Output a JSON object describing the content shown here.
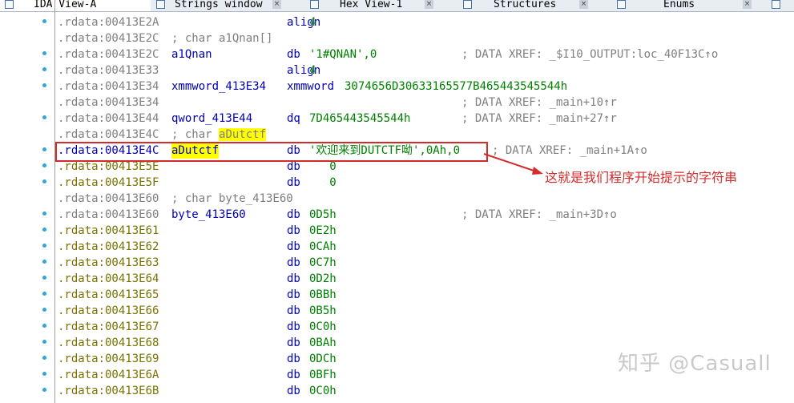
{
  "tabs": [
    {
      "label": "IDA View-A",
      "icon": "ida-view-icon",
      "active": true
    },
    {
      "label": "Strings window",
      "icon": "strings-icon",
      "active": false
    },
    {
      "label": "Hex View-1",
      "icon": "hex-view-icon",
      "active": false
    },
    {
      "label": "Structures",
      "icon": "structures-icon",
      "active": false
    },
    {
      "label": "Enums",
      "icon": "enums-icon",
      "active": false
    },
    {
      "label": "",
      "icon": "imports-icon",
      "active": false
    }
  ],
  "close_glyph": "×",
  "rows": [
    {
      "addr": ".rdata:00413E2A",
      "name": "",
      "mnemonic": "align",
      "operand": "4",
      "comment": ""
    },
    {
      "addr": ".rdata:00413E2C",
      "decl": "; char a1Qnan[]"
    },
    {
      "addr": ".rdata:00413E2C",
      "name": "a1Qnan",
      "mnemonic": "db",
      "operand": "'1#QNAN',0",
      "comment": "; DATA XREF: _$I10_OUTPUT:loc_40F13C↑o"
    },
    {
      "addr": ".rdata:00413E33",
      "name": "",
      "mnemonic": "align",
      "operand": "4",
      "comment": ""
    },
    {
      "addr": ".rdata:00413E34",
      "name": "xmmword_413E34",
      "mnemonic": "xmmword",
      "operand": "3074656D30633165577B465443545544h",
      "comment": ""
    },
    {
      "addr": ".rdata:00413E34",
      "name": "",
      "mnemonic": "",
      "operand": "",
      "comment": "; DATA XREF: _main+10↑r"
    },
    {
      "addr": ".rdata:00413E44",
      "name": "qword_413E44",
      "mnemonic": "dq",
      "operand": "7D465443545544h",
      "comment": "; DATA XREF: _main+27↑r"
    },
    {
      "addr": ".rdata:00413E4C",
      "decl_prefix": "; char ",
      "decl_hl": "aDutctf"
    },
    {
      "addr": ".rdata:00413E4C",
      "name": "aDutctf",
      "mnemonic": "db",
      "operand": "'欢迎来到DUTCTF呦',0Ah,0",
      "comment": "; DATA XREF: _main+1A↑o"
    },
    {
      "addr": ".rdata:00413E5E",
      "name": "",
      "mnemonic": "db",
      "operand": "   0",
      "comment": ""
    },
    {
      "addr": ".rdata:00413E5F",
      "name": "",
      "mnemonic": "db",
      "operand": "   0",
      "comment": ""
    },
    {
      "addr": ".rdata:00413E60",
      "decl": "; char byte_413E60"
    },
    {
      "addr": ".rdata:00413E60",
      "name": "byte_413E60",
      "mnemonic": "db",
      "operand": "0D5h",
      "comment": "; DATA XREF: _main+3D↑o"
    },
    {
      "addr": ".rdata:00413E61",
      "name": "",
      "mnemonic": "db",
      "operand": "0E2h",
      "comment": ""
    },
    {
      "addr": ".rdata:00413E62",
      "name": "",
      "mnemonic": "db",
      "operand": "0CAh",
      "comment": ""
    },
    {
      "addr": ".rdata:00413E63",
      "name": "",
      "mnemonic": "db",
      "operand": "0C7h",
      "comment": ""
    },
    {
      "addr": ".rdata:00413E64",
      "name": "",
      "mnemonic": "db",
      "operand": "0D2h",
      "comment": ""
    },
    {
      "addr": ".rdata:00413E65",
      "name": "",
      "mnemonic": "db",
      "operand": "0BBh",
      "comment": ""
    },
    {
      "addr": ".rdata:00413E66",
      "name": "",
      "mnemonic": "db",
      "operand": "0B5h",
      "comment": ""
    },
    {
      "addr": ".rdata:00413E67",
      "name": "",
      "mnemonic": "db",
      "operand": "0C0h",
      "comment": ""
    },
    {
      "addr": ".rdata:00413E68",
      "name": "",
      "mnemonic": "db",
      "operand": "0BAh",
      "comment": ""
    },
    {
      "addr": ".rdata:00413E69",
      "name": "",
      "mnemonic": "db",
      "operand": "0DCh",
      "comment": ""
    },
    {
      "addr": ".rdata:00413E6A",
      "name": "",
      "mnemonic": "db",
      "operand": "0BFh",
      "comment": ""
    },
    {
      "addr": ".rdata:00413E6B",
      "name": "",
      "mnemonic": "db",
      "operand": "0C0h",
      "comment": ""
    }
  ],
  "annotation": "这就是我们程序开始提示的字符串",
  "watermark": "知乎 @Casuall",
  "colors": {
    "address": "#7f7f7f",
    "address_data": "#7a7200",
    "name": "#0000b4",
    "operand": "#008000",
    "comment": "#7f7f7f",
    "highlight": "#ffff00",
    "annotation_red": "#d42b2b",
    "breakpoint_dot": "#2fa7d6"
  }
}
